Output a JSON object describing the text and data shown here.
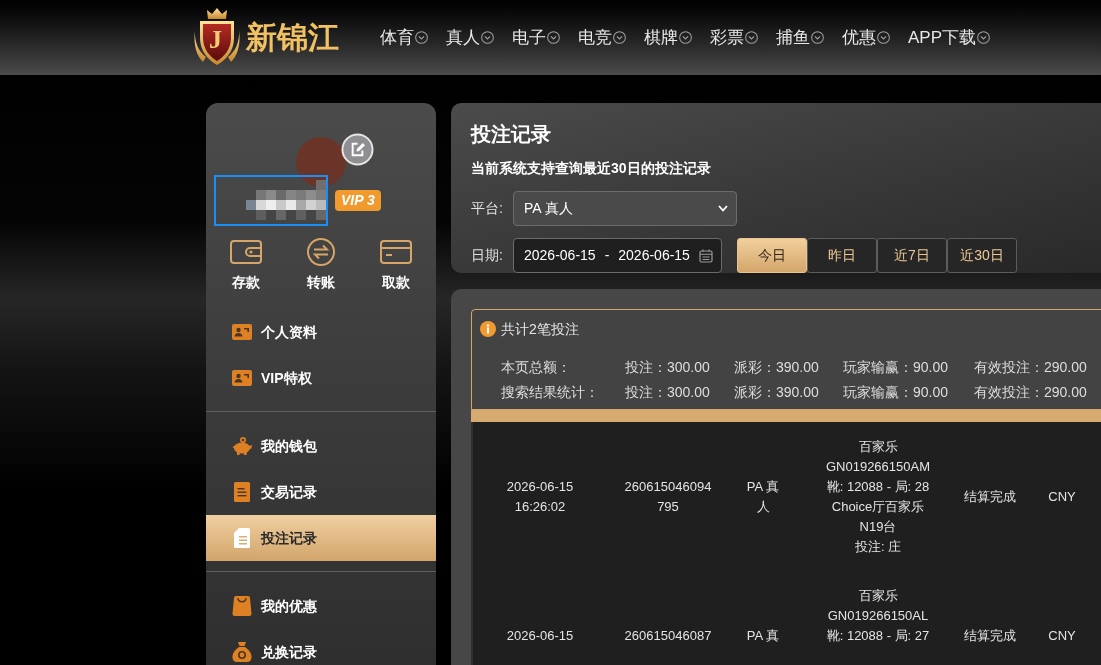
{
  "header": {
    "logo": {
      "mark": "J",
      "text": "新锦江"
    },
    "nav": [
      "体育",
      "真人",
      "电子",
      "电竞",
      "棋牌",
      "彩票",
      "捕鱼",
      "优惠",
      "APP下载"
    ]
  },
  "sidebar": {
    "vip_badge": "VIP 3",
    "actions": [
      {
        "kind": "deposit",
        "label": "存款"
      },
      {
        "kind": "transfer",
        "label": "转账"
      },
      {
        "kind": "withdraw",
        "label": "取款"
      }
    ],
    "menu_groups": [
      {
        "items": [
          {
            "kind": "profile",
            "label": "个人资料",
            "selected": false
          },
          {
            "kind": "vip",
            "label": "VIP特权",
            "selected": false
          }
        ]
      },
      {
        "items": [
          {
            "kind": "wallet",
            "label": "我的钱包",
            "selected": false
          },
          {
            "kind": "transactions",
            "label": "交易记录",
            "selected": false
          },
          {
            "kind": "bets",
            "label": "投注记录",
            "selected": true
          }
        ]
      },
      {
        "items": [
          {
            "kind": "promotions",
            "label": "我的优惠",
            "selected": false
          },
          {
            "kind": "redeem",
            "label": "兑换记录",
            "selected": false
          }
        ]
      }
    ]
  },
  "query_panel": {
    "title": "投注记录",
    "note": "当前系统支持查询最近30日的投注记录",
    "platform": {
      "label": "平台:",
      "value": "PA 真人"
    },
    "date": {
      "label": "日期:",
      "start": "2026-06-15",
      "separator": "-",
      "end": "2026-06-15"
    },
    "quick_ranges": [
      {
        "label": "今日",
        "selected": true
      },
      {
        "label": "昨日",
        "selected": false
      },
      {
        "label": "近7日",
        "selected": false
      },
      {
        "label": "近30日",
        "selected": false
      }
    ]
  },
  "results": {
    "summary": {
      "count_text": "共计2笔投注",
      "rows": [
        {
          "label": "本页总额：",
          "values": [
            "投注：300.00",
            "派彩：390.00",
            "玩家输赢：90.00",
            "有效投注：290.00"
          ]
        },
        {
          "label": "搜索结果统计：",
          "values": [
            "投注：300.00",
            "派彩：390.00",
            "玩家输赢：90.00",
            "有效投注：290.00"
          ]
        }
      ]
    },
    "table": {
      "rows": [
        {
          "cells": [
            [
              "2026-06-15",
              "16:26:02"
            ],
            [
              "260615046094",
              "795"
            ],
            [
              "PA 真",
              "人"
            ],
            [
              "百家乐",
              "GN019266150AM",
              "靴: 12088 - 局: 28",
              "Choice厅百家乐",
              "N19台",
              "投注: 庄"
            ],
            [
              "结算完成"
            ],
            [
              "CNY"
            ]
          ]
        },
        {
          "cells": [
            [
              "2026-06-15"
            ],
            [
              "260615046087"
            ],
            [
              "PA 真"
            ],
            [
              "百家乐",
              "GN019266150AL",
              "靴: 12088 - 局: 27"
            ],
            [
              "结算完成"
            ],
            [
              "CNY"
            ]
          ]
        }
      ]
    }
  }
}
